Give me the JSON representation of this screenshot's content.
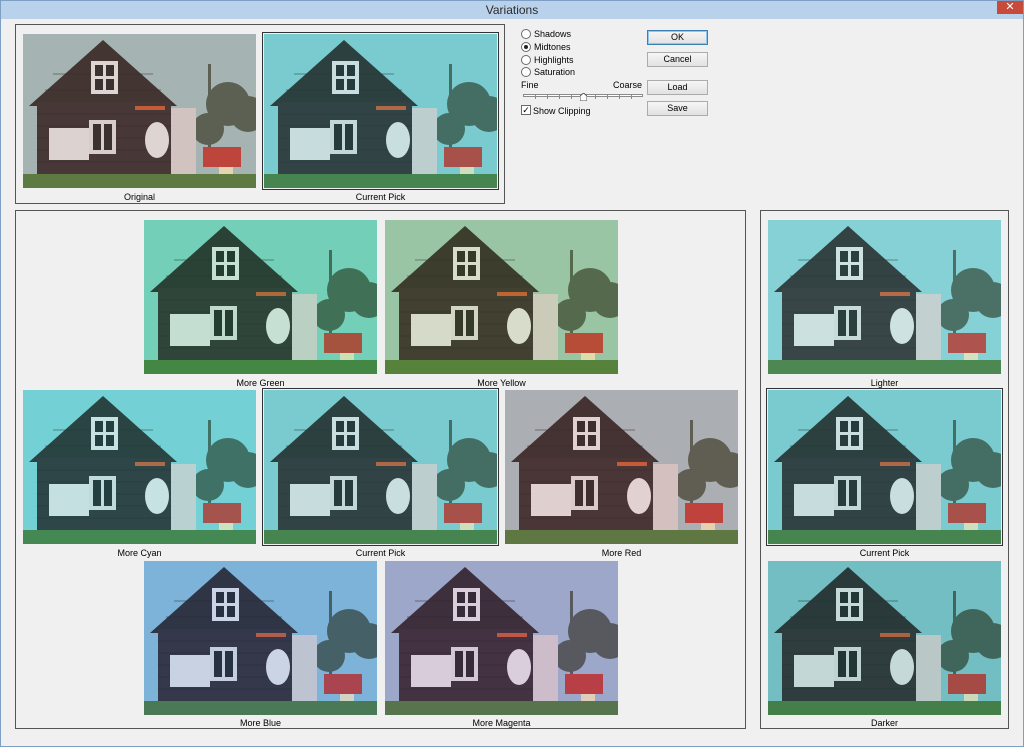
{
  "window": {
    "title": "Variations",
    "close_label": "✕"
  },
  "top_previews": [
    {
      "caption": "Original",
      "tint": "#b07a6a"
    },
    {
      "caption": "Current Pick",
      "tint": "#3fb8b8"
    }
  ],
  "options": {
    "radios": [
      {
        "label": "Shadows",
        "checked": false
      },
      {
        "label": "Midtones",
        "checked": true
      },
      {
        "label": "Highlights",
        "checked": false
      },
      {
        "label": "Saturation",
        "checked": false
      }
    ],
    "fine_label": "Fine",
    "coarse_label": "Coarse",
    "slider_value_fraction": 0.5,
    "show_clipping_label": "Show Clipping",
    "show_clipping_checked": true,
    "show_clipping_mark": "✓"
  },
  "buttons": {
    "ok": "OK",
    "cancel": "Cancel",
    "load": "Load",
    "save": "Save"
  },
  "color_variations": [
    {
      "caption": "More Green",
      "tint": "#2fc07a"
    },
    {
      "caption": "More Yellow",
      "tint": "#8fa84a"
    },
    {
      "caption": "More Cyan",
      "tint": "#2fc6c8"
    },
    {
      "caption": "Current Pick",
      "tint": "#3fb8b8"
    },
    {
      "caption": "More Red",
      "tint": "#c06a6a"
    },
    {
      "caption": "More Blue",
      "tint": "#4a78d0"
    },
    {
      "caption": "More Magenta",
      "tint": "#9a5aa8"
    }
  ],
  "brightness_variations": [
    {
      "caption": "Lighter",
      "tint": "#5cc8c8"
    },
    {
      "caption": "Current Pick",
      "tint": "#3fb8b8"
    },
    {
      "caption": "Darker",
      "tint": "#2a9494"
    }
  ]
}
